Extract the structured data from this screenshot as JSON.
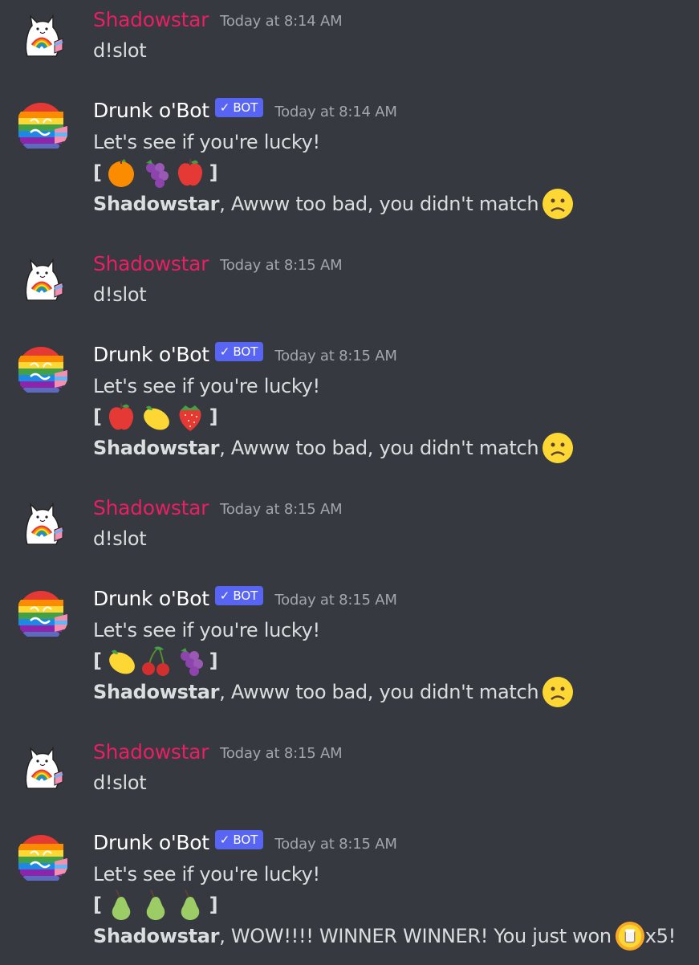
{
  "channel": {
    "messages": [
      {
        "author": "Shadowstar",
        "role": "user",
        "timestamp": "Today at 8:14 AM",
        "content": "d!slot"
      },
      {
        "author": "Drunk o'Bot",
        "role": "bot",
        "badge": "BOT",
        "timestamp": "Today at 8:14 AM",
        "intro": "Let's see if you're lucky!",
        "bracket_open": "[",
        "bracket_close": "]",
        "reels": [
          "orange-emoji",
          "grapes-emoji",
          "apple-emoji"
        ],
        "result_name": "Shadowstar",
        "result_text": ", Awww too bad, you didn't match",
        "result_emoji": "frowning-face-emoji"
      },
      {
        "author": "Shadowstar",
        "role": "user",
        "timestamp": "Today at 8:15 AM",
        "content": "d!slot"
      },
      {
        "author": "Drunk o'Bot",
        "role": "bot",
        "badge": "BOT",
        "timestamp": "Today at 8:15 AM",
        "intro": "Let's see if you're lucky!",
        "bracket_open": "[",
        "bracket_close": "]",
        "reels": [
          "apple-emoji",
          "lemon-emoji",
          "strawberry-emoji"
        ],
        "result_name": "Shadowstar",
        "result_text": ", Awww too bad, you didn't match",
        "result_emoji": "frowning-face-emoji"
      },
      {
        "author": "Shadowstar",
        "role": "user",
        "timestamp": "Today at 8:15 AM",
        "content": "d!slot"
      },
      {
        "author": "Drunk o'Bot",
        "role": "bot",
        "badge": "BOT",
        "timestamp": "Today at 8:15 AM",
        "intro": "Let's see if you're lucky!",
        "bracket_open": "[",
        "bracket_close": "]",
        "reels": [
          "lemon-emoji",
          "cherries-emoji",
          "grapes-emoji"
        ],
        "result_name": "Shadowstar",
        "result_text": ", Awww too bad, you didn't match",
        "result_emoji": "frowning-face-emoji"
      },
      {
        "author": "Shadowstar",
        "role": "user",
        "timestamp": "Today at 8:15 AM",
        "content": "d!slot"
      },
      {
        "author": "Drunk o'Bot",
        "role": "bot",
        "badge": "BOT",
        "timestamp": "Today at 8:15 AM",
        "intro": "Let's see if you're lucky!",
        "bracket_open": "[",
        "bracket_close": "]",
        "reels": [
          "pear-emoji",
          "pear-emoji",
          "pear-emoji"
        ],
        "result_name": "Shadowstar",
        "result_text": ", WOW!!!! WINNER WINNER! You just won",
        "result_emoji": "coin-emoji",
        "result_suffix": "x5!"
      }
    ]
  },
  "colors": {
    "background": "#36393f",
    "user_name": "#e91e63",
    "bot_name": "#ffffff",
    "bot_badge": "#5865f2",
    "timestamp": "#a3a6aa",
    "text": "#dcddde"
  },
  "icons": {
    "check": "✓"
  }
}
